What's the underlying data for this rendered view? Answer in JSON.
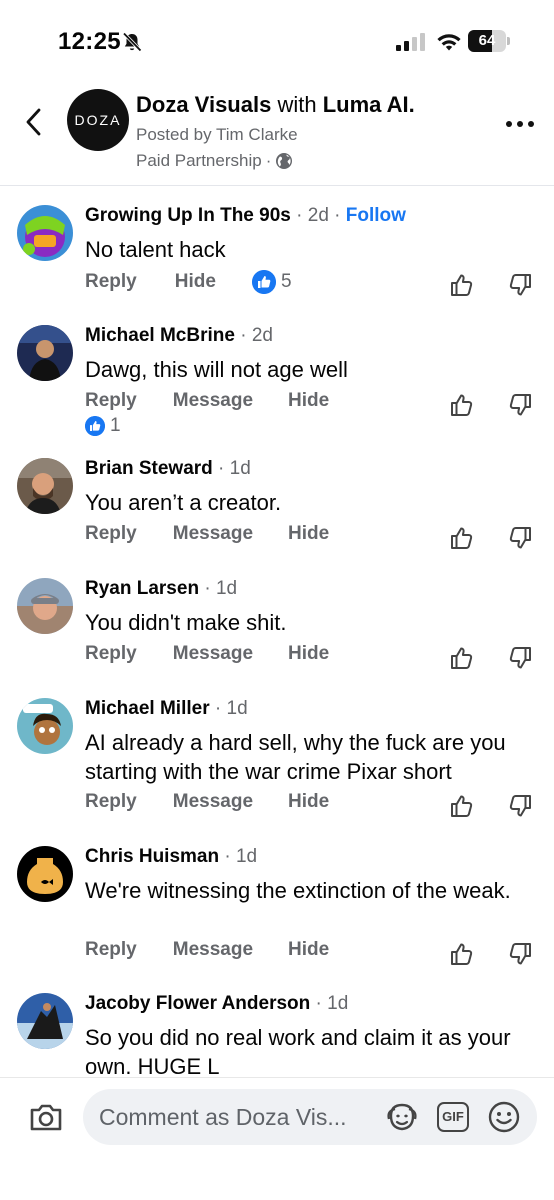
{
  "status_bar": {
    "time": "12:25",
    "battery": "64",
    "battery_level": 0.64
  },
  "header": {
    "page_name": "Doza Visuals",
    "with_label": "with",
    "partner_name": "Luma AI.",
    "avatar_text": "DOZA",
    "posted_by": "Posted by Tim Clarke",
    "paid_label": "Paid Partnership",
    "separator": "·"
  },
  "comments": [
    {
      "name": "Growing Up In The 90s",
      "time": "2d",
      "follow": "Follow",
      "text": "No talent hack",
      "actions": [
        "Reply",
        "Hide"
      ],
      "likes": "5"
    },
    {
      "name": "Michael McBrine",
      "time": "2d",
      "text": "Dawg, this will not age well",
      "actions": [
        "Reply",
        "Message",
        "Hide"
      ],
      "likes": "1"
    },
    {
      "name": "Brian Steward",
      "time": "1d",
      "text": "You aren’t a creator.",
      "actions": [
        "Reply",
        "Message",
        "Hide"
      ]
    },
    {
      "name": "Ryan Larsen",
      "time": "1d",
      "text": "You didn't make shit.",
      "actions": [
        "Reply",
        "Message",
        "Hide"
      ]
    },
    {
      "name": "Michael Miller",
      "time": "1d",
      "text": "AI already a hard sell, why the fuck are you starting with the war crime Pixar short",
      "actions": [
        "Reply",
        "Message",
        "Hide"
      ]
    },
    {
      "name": "Chris Huisman",
      "time": "1d",
      "text": "We're witnessing the extinction of the weak.",
      "actions": [
        "Reply",
        "Message",
        "Hide"
      ]
    },
    {
      "name": "Jacoby Flower Anderson",
      "time": "1d",
      "text": "So you did no real work and claim it as your own. HUGE L"
    }
  ],
  "composer": {
    "placeholder": "Comment as Doza Vis...",
    "gif_label": "GIF"
  },
  "icons": {
    "back": "chevron-left-icon",
    "more": "more-horizontal-icon",
    "upvote": "thumbs-up-outline-icon",
    "downvote": "thumbs-down-outline-icon",
    "camera": "camera-icon",
    "avatar_sticker": "avatar-sticker-icon",
    "emoji": "smiley-icon",
    "audience": "globe-icon"
  },
  "colors": {
    "accent": "#1877f2",
    "secondary_text": "#65676b",
    "composer_bg": "#eff1f4"
  }
}
